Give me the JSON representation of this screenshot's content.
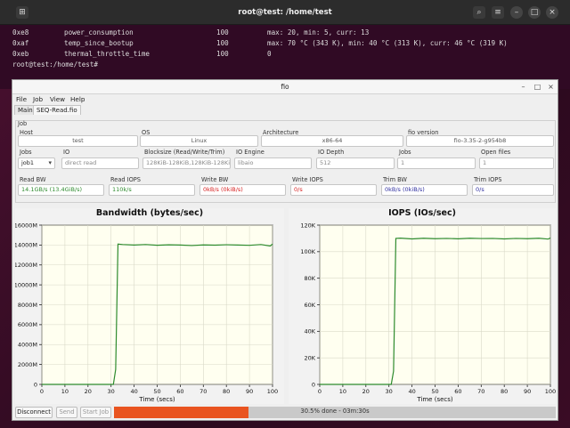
{
  "terminal": {
    "title": "root@test: /home/test",
    "rows": [
      {
        "addr": "0xe8",
        "name": "power_consumption",
        "norm": "100",
        "raw": "max: 20, min: 5, curr: 13"
      },
      {
        "addr": "0xaf",
        "name": "temp_since_bootup",
        "norm": "100",
        "raw": "max: 70 °C (343 K), min: 40 °C (313 K), curr: 46 °C (319 K)"
      },
      {
        "addr": "0xeb",
        "name": "thermal_throttle_time",
        "norm": "100",
        "raw": "0"
      }
    ],
    "prompt": "root@test:/home/test#"
  },
  "window": {
    "title": "fio",
    "menu": [
      "File",
      "Job",
      "View",
      "Help"
    ],
    "tabs": [
      "Main",
      "SEQ-Read.fio"
    ],
    "active_tab": 1
  },
  "job": {
    "section_label": "Job",
    "host_label": "Host",
    "host": "test",
    "os_label": "OS",
    "os": "Linux",
    "arch_label": "Architecture",
    "arch": "x86-64",
    "fio_version_label": "fio version",
    "fio_version": "fio-3.35-2-g954b8",
    "jobs_label": "Jobs",
    "jobs_select": "job1",
    "io_label": "IO",
    "io": "direct read",
    "blocksize_label": "Blocksize (Read/Write/Trim)",
    "blocksize": "128KiB-128KiB,128KiB-128Ki",
    "ioengine_label": "IO Engine",
    "ioengine": "libaio",
    "iodepth_label": "IO Depth",
    "iodepth": "512",
    "jobs2_label": "Jobs",
    "jobs2": "1",
    "openfiles_label": "Open files",
    "openfiles": "1"
  },
  "stats": {
    "read_bw_label": "Read BW",
    "read_bw": "14.1GB/s (13.4GiB/s)",
    "read_iops_label": "Read IOPS",
    "read_iops": "110k/s",
    "write_bw_label": "Write BW",
    "write_bw": "0kB/s (0kiB/s)",
    "write_iops_label": "Write IOPS",
    "write_iops": "0/s",
    "trim_bw_label": "Trim BW",
    "trim_bw": "0kB/s (0kiB/s)",
    "trim_iops_label": "Trim IOPS",
    "trim_iops": "0/s",
    "colors": {
      "read": "#2e8b2e",
      "write": "#d62020",
      "trim": "#3030a0"
    }
  },
  "chart_data": [
    {
      "type": "line",
      "title": "Bandwidth (bytes/sec)",
      "xlabel": "Time (secs)",
      "ylabel": "",
      "xlim": [
        0,
        100
      ],
      "ylim": [
        0,
        16000
      ],
      "x_ticks": [
        0,
        10,
        20,
        30,
        40,
        50,
        60,
        70,
        80,
        90,
        100
      ],
      "y_ticks": [
        0,
        2000,
        4000,
        6000,
        8000,
        10000,
        12000,
        14000,
        16000
      ],
      "y_tick_labels": [
        "0",
        "2000M",
        "4000M",
        "6000M",
        "8000M",
        "10000M",
        "12000M",
        "14000M",
        "16000M"
      ],
      "grid": true,
      "color": "#2e8b2e",
      "series": [
        {
          "x": [
            0,
            31,
            32,
            33,
            35,
            40,
            45,
            50,
            55,
            60,
            65,
            70,
            75,
            80,
            85,
            90,
            95,
            99,
            100
          ],
          "y": [
            0,
            0,
            1500,
            14100,
            14050,
            14000,
            14050,
            13980,
            14020,
            14000,
            13950,
            14010,
            13990,
            14030,
            14000,
            13970,
            14050,
            13900,
            14100
          ]
        }
      ]
    },
    {
      "type": "line",
      "title": "IOPS (IOs/sec)",
      "xlabel": "Time (secs)",
      "ylabel": "",
      "xlim": [
        0,
        100
      ],
      "ylim": [
        0,
        120000
      ],
      "x_ticks": [
        0,
        10,
        20,
        30,
        40,
        50,
        60,
        70,
        80,
        90,
        100
      ],
      "y_ticks": [
        0,
        20000,
        40000,
        60000,
        80000,
        100000,
        120000
      ],
      "y_tick_labels": [
        "0",
        "20K",
        "40K",
        "60K",
        "80K",
        "100K",
        "120K"
      ],
      "grid": true,
      "color": "#2e8b2e",
      "series": [
        {
          "x": [
            0,
            31,
            32,
            33,
            35,
            40,
            45,
            50,
            55,
            60,
            65,
            70,
            75,
            80,
            85,
            90,
            95,
            99,
            100
          ],
          "y": [
            0,
            0,
            10000,
            110000,
            110200,
            109600,
            110100,
            109800,
            110000,
            109700,
            110100,
            109900,
            110000,
            109600,
            110000,
            109800,
            110100,
            109500,
            110300
          ]
        }
      ]
    }
  ],
  "bottom": {
    "disconnect": "Disconnect",
    "send": "Send",
    "start_job": "Start Job",
    "progress": 0.305,
    "progress_text": "30.5% done - 03m:30s",
    "progress_color": "#e95420"
  }
}
